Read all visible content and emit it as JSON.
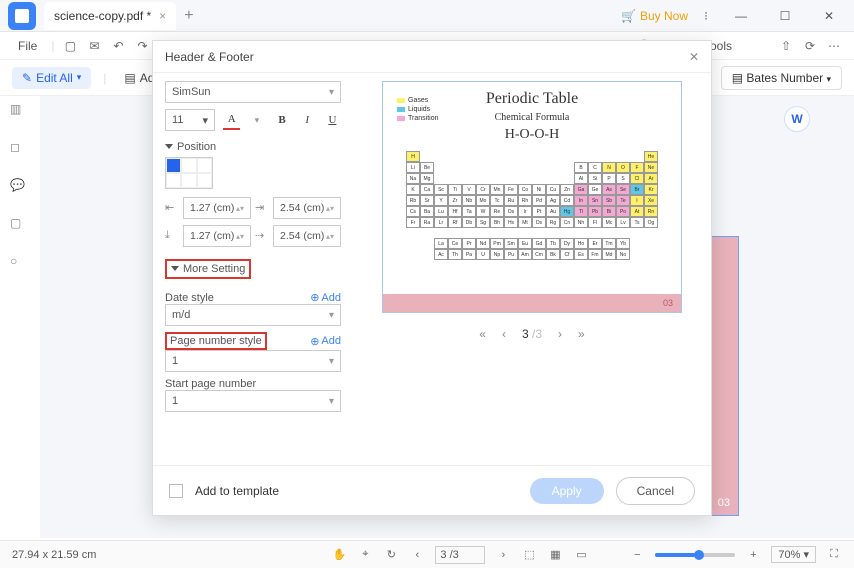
{
  "titlebar": {
    "tab_name": "science-copy.pdf *",
    "buy_now": "Buy Now"
  },
  "menubar": {
    "file": "File",
    "search": "Search Tools"
  },
  "toolbar": {
    "edit_all": "Edit All",
    "add": "Add",
    "bates": "Bates Number"
  },
  "dialog": {
    "title": "Header & Footer",
    "font_family": "SimSun",
    "font_size": "11",
    "position_label": "Position",
    "margins": {
      "left": "1.27 (cm)",
      "right": "2.54 (cm)",
      "top": "1.27 (cm)",
      "bottom": "2.54 (cm)"
    },
    "more_setting": "More Setting",
    "date_style_label": "Date style",
    "date_style_value": "m/d",
    "add_label": "Add",
    "page_num_label": "Page number style",
    "page_num_value": "1",
    "start_page_label": "Start page number",
    "start_page_value": "1",
    "add_template": "Add to template",
    "apply": "Apply",
    "cancel": "Cancel"
  },
  "preview": {
    "title": "Periodic Table",
    "subtitle": "Chemical Formula",
    "formula": "H-O-O-H",
    "legend": [
      "Gases",
      "Liquids",
      "Transition"
    ],
    "row1": [
      "H",
      "",
      "",
      "",
      "",
      "",
      "",
      "",
      "",
      "",
      "",
      "",
      "",
      "",
      "",
      "",
      "",
      "He"
    ],
    "row2": [
      "Li",
      "Be",
      "",
      "",
      "",
      "",
      "",
      "",
      "",
      "",
      "",
      "",
      "B",
      "C",
      "N",
      "O",
      "F",
      "Ne"
    ],
    "row3": [
      "Na",
      "Mg",
      "",
      "",
      "",
      "",
      "",
      "",
      "",
      "",
      "",
      "",
      "Al",
      "Si",
      "P",
      "S",
      "Cl",
      "Ar"
    ],
    "row4": [
      "K",
      "Ca",
      "Sc",
      "Ti",
      "V",
      "Cr",
      "Mn",
      "Fe",
      "Co",
      "Ni",
      "Cu",
      "Zn",
      "Ga",
      "Ge",
      "As",
      "Se",
      "Br",
      "Kr"
    ],
    "row5": [
      "Rb",
      "Sr",
      "Y",
      "Zr",
      "Nb",
      "Mo",
      "Tc",
      "Ru",
      "Rh",
      "Pd",
      "Ag",
      "Cd",
      "In",
      "Sn",
      "Sb",
      "Te",
      "I",
      "Xe"
    ],
    "row6": [
      "Cs",
      "Ba",
      "Lu",
      "Hf",
      "Ta",
      "W",
      "Re",
      "Os",
      "Ir",
      "Pt",
      "Au",
      "Hg",
      "Tl",
      "Pb",
      "Bi",
      "Po",
      "At",
      "Rn"
    ],
    "row7": [
      "Fr",
      "Ra",
      "Lr",
      "Rf",
      "Db",
      "Sg",
      "Bh",
      "Hs",
      "Mt",
      "Ds",
      "Rg",
      "Cn",
      "Nh",
      "Fl",
      "Mc",
      "Lv",
      "Ts",
      "Og"
    ],
    "lan": [
      "La",
      "Ce",
      "Pr",
      "Nd",
      "Pm",
      "Sm",
      "Eu",
      "Gd",
      "Tb",
      "Dy",
      "Ho",
      "Er",
      "Tm",
      "Yb"
    ],
    "act": [
      "Ac",
      "Th",
      "Pa",
      "U",
      "Np",
      "Pu",
      "Am",
      "Cm",
      "Bk",
      "Cf",
      "Es",
      "Fm",
      "Md",
      "No"
    ],
    "foot_num": "03",
    "pager_current": "3",
    "pager_total": "/3"
  },
  "statusbar": {
    "dims": "27.94 x 21.59 cm",
    "page": "3 /3",
    "zoom": "70%"
  }
}
